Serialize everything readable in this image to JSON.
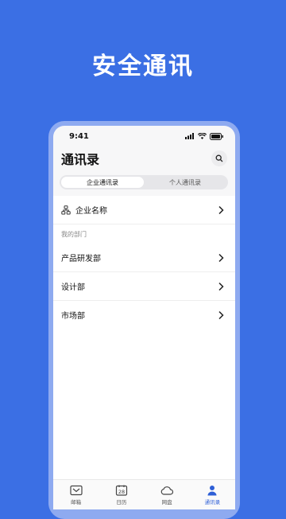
{
  "hero": {
    "title": "安全通讯"
  },
  "status_bar": {
    "time": "9:41"
  },
  "header": {
    "title": "通讯录"
  },
  "tabs": [
    {
      "label": "企业通讯录",
      "active": true
    },
    {
      "label": "个人通讯录",
      "active": false
    }
  ],
  "company": {
    "name": "企业名称"
  },
  "section": {
    "label": "我的部门"
  },
  "departments": [
    {
      "label": "产品研发部"
    },
    {
      "label": "设计部"
    },
    {
      "label": "市场部"
    }
  ],
  "bottom_nav": [
    {
      "label": "邮箱",
      "icon": "mail-icon",
      "active": false
    },
    {
      "label": "日历",
      "icon": "calendar-icon",
      "active": false,
      "badge": "28"
    },
    {
      "label": "网盘",
      "icon": "cloud-icon",
      "active": false
    },
    {
      "label": "通讯录",
      "icon": "contacts-icon",
      "active": true
    }
  ],
  "colors": {
    "background": "#3b6fe4",
    "accent": "#2e5fd6"
  }
}
